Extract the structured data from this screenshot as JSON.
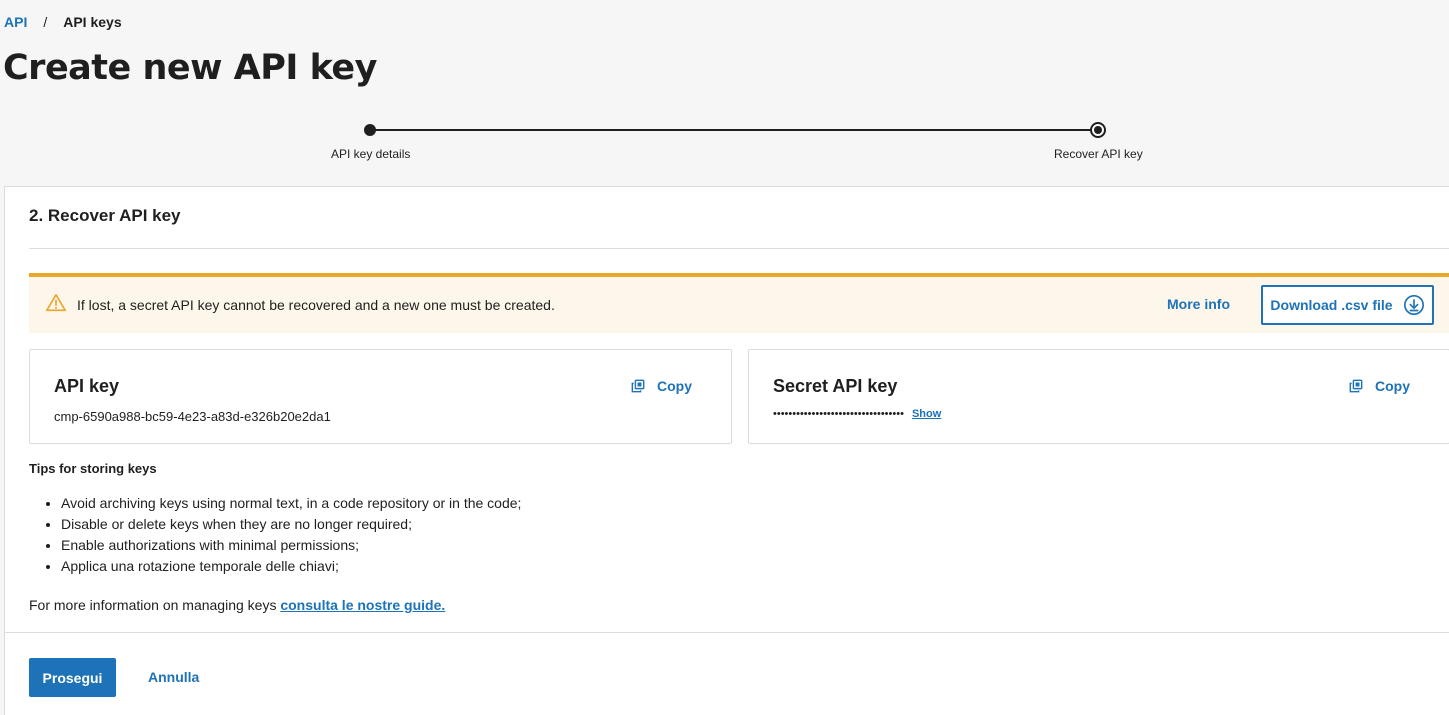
{
  "breadcrumb": {
    "root": "API",
    "separator": "/",
    "current": "API keys"
  },
  "page": {
    "title": "Create new API key"
  },
  "stepper": {
    "steps": [
      {
        "label": "API key details",
        "state": "completed"
      },
      {
        "label": "Recover API key",
        "state": "current"
      }
    ]
  },
  "section": {
    "title": "2. Recover API key"
  },
  "alert": {
    "icon": "warning-icon",
    "text": "If lost, a secret API key cannot be recovered and a new one must be created.",
    "more_info": "More info",
    "download_label": "Download .csv file"
  },
  "api_key": {
    "title": "API key",
    "copy_label": "Copy",
    "value": "cmp-6590a988-bc59-4e23-a83d-e326b20e2da1"
  },
  "secret_key": {
    "title": "Secret API key",
    "copy_label": "Copy",
    "masked_value": "••••••••••••••••••••••••••••••••••",
    "show_label": "Show"
  },
  "tips": {
    "title": "Tips for storing keys",
    "items": [
      "Avoid archiving keys using normal text, in a code repository or in the code;",
      "Disable or delete keys when they are no longer required;",
      "Enable authorizations with minimal permissions;",
      "Applica una rotazione temporale delle chiavi;"
    ]
  },
  "more_info": {
    "text": "For more information on managing keys ",
    "link": "consulta le nostre guide."
  },
  "actions": {
    "primary": "Prosegui",
    "cancel": "Annulla"
  },
  "colors": {
    "accent": "#1d72b8",
    "warning": "#e8a72b",
    "warning_bg": "#fdf6ea"
  }
}
